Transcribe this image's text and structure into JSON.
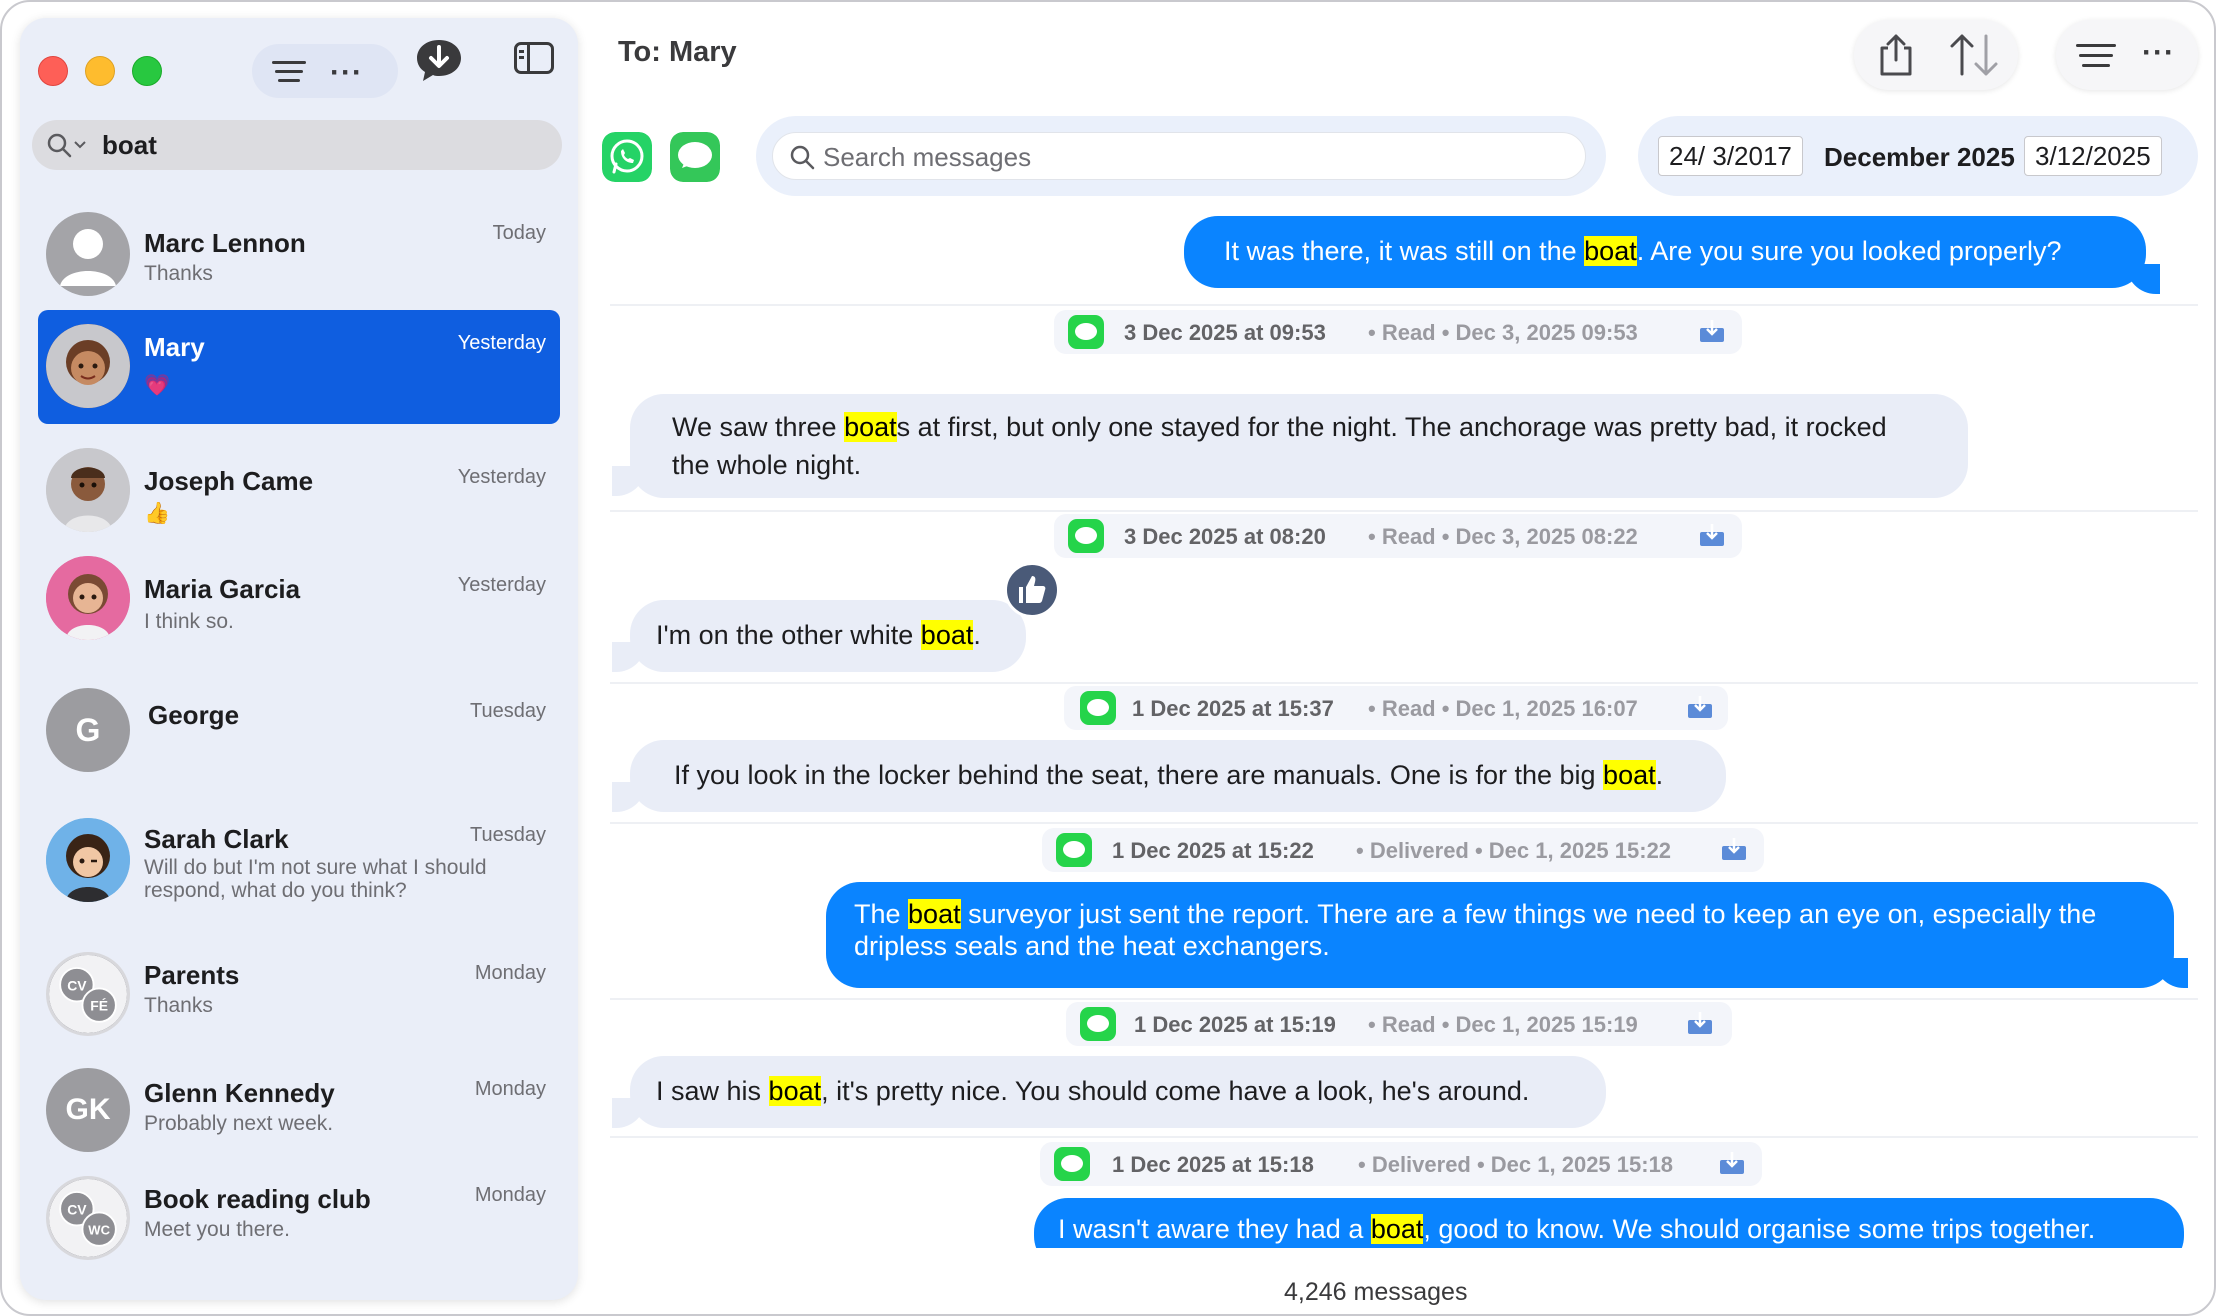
{
  "window": {
    "recipient_label": "To: Mary"
  },
  "sidebar": {
    "search_value": "boat",
    "conversations": [
      {
        "name": "Marc Lennon",
        "time": "Today",
        "snippet": "Thanks",
        "avatar_text": "",
        "avatar_color": "#a4a4a8"
      },
      {
        "name": "Mary",
        "time": "Yesterday",
        "snippet": "💗",
        "avatar_text": "",
        "avatar_color": "#b07a5a"
      },
      {
        "name": "Joseph Came",
        "time": "Yesterday",
        "snippet": "👍",
        "avatar_text": "",
        "avatar_color": "#8a6a54"
      },
      {
        "name": "Maria Garcia",
        "time": "Yesterday",
        "snippet": "I think so.",
        "avatar_text": "",
        "avatar_color": "#e56aa0"
      },
      {
        "name": "George",
        "time": "Tuesday",
        "snippet": "",
        "avatar_text": "G",
        "avatar_color": "#9c9ca0"
      },
      {
        "name": "Sarah Clark",
        "time": "Tuesday",
        "snippet": "Will do but I'm not sure what I should respond, what do you think?",
        "avatar_text": "",
        "avatar_color": "#6fb2e8"
      },
      {
        "name": "Parents",
        "time": "Monday",
        "snippet": "Thanks",
        "avatar_text": "CV FÉ",
        "avatar_color": "#8e8e93"
      },
      {
        "name": "Glenn Kennedy",
        "time": "Monday",
        "snippet": "Probably next week.",
        "avatar_text": "GK",
        "avatar_color": "#9c9ca0"
      },
      {
        "name": "Book reading club",
        "time": "Monday",
        "snippet": "Meet you there.",
        "avatar_text": "CV WC",
        "avatar_color": "#8e8e93"
      }
    ]
  },
  "search": {
    "placeholder": "Search messages"
  },
  "date_range": {
    "start": "24/  3/2017",
    "month": "December 2025",
    "end": "3/12/2025"
  },
  "messages": [
    {
      "dir": "out",
      "pre": "It was there, it was still on the ",
      "hl": "boat",
      "post": ". Are you sure you looked properly?"
    },
    {
      "dir": "in",
      "pre": "We saw three ",
      "hl": "boat",
      "post": "s at first, but only one stayed for the night. The anchorage was pretty bad, it rocked the whole night."
    },
    {
      "dir": "in",
      "pre": "I'm on the other white ",
      "hl": "boat",
      "post": "."
    },
    {
      "dir": "in",
      "pre": "If you look in the locker behind the seat, there are manuals. One is for the big ",
      "hl": "boat",
      "post": "."
    },
    {
      "dir": "out",
      "pre": "The ",
      "hl": "boat",
      "post": " surveyor just sent the report. There are a few things we need to keep an eye on, especially the dripless seals and the heat exchangers."
    },
    {
      "dir": "in",
      "pre": "I saw his ",
      "hl": "boat",
      "post": ", it's pretty nice. You should come have a look, he's around."
    },
    {
      "dir": "out",
      "pre": "I wasn't aware they had a ",
      "hl": "boat",
      "post": ", good to know. We should organise some trips together."
    }
  ],
  "meta": [
    {
      "stamp": "3 Dec 2025 at 09:53",
      "rest": "• Read • Dec 3, 2025  09:53"
    },
    {
      "stamp": "3 Dec 2025 at 08:20",
      "rest": "• Read • Dec 3, 2025  08:22"
    },
    {
      "stamp": "1 Dec 2025 at 15:37",
      "rest": "• Read • Dec 1, 2025  16:07"
    },
    {
      "stamp": "1 Dec 2025 at 15:22",
      "rest": "• Delivered • Dec 1, 2025  15:22"
    },
    {
      "stamp": "1 Dec 2025 at 15:19",
      "rest": "• Read • Dec 1, 2025  15:19"
    },
    {
      "stamp": "1 Dec 2025 at 15:18",
      "rest": "• Delivered • Dec 1, 2025  15:18"
    }
  ],
  "footer": {
    "count": "4,246 messages"
  },
  "colors": {
    "accent": "#0a84ff",
    "selected": "#0f5ee0",
    "highlight": "#ffff00",
    "whatsapp": "#25d366",
    "messages": "#34c759"
  },
  "icons": [
    "search-icon",
    "filter-icon",
    "more-icon",
    "compose-icon",
    "sidebar-toggle-icon",
    "share-icon",
    "sort-icon",
    "whatsapp-icon",
    "messages-icon",
    "download-icon",
    "thumbs-up-icon"
  ]
}
